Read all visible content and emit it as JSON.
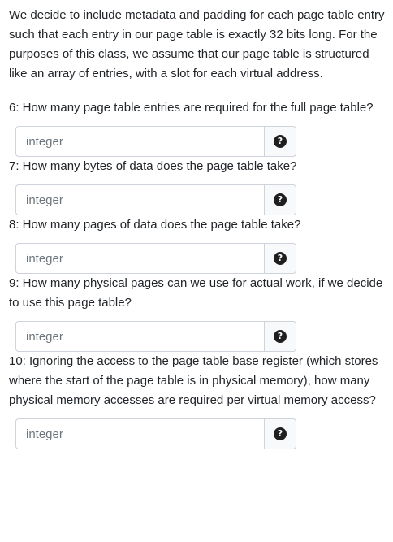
{
  "intro": "We decide to include metadata and padding for each page table entry such that each entry in our page table is exactly 32 bits long. For the purposes of this class, we assume that our page table is structured like an array of entries, with a slot for each virtual address.",
  "questions": [
    {
      "text": "6: How many page table entries are required for the full page table?",
      "placeholder": "integer",
      "help_icon": "question-circle-icon"
    },
    {
      "text": "7: How many bytes of data does the page table take?",
      "placeholder": "integer",
      "help_icon": "question-circle-icon"
    },
    {
      "text": "8: How many pages of data does the page table take?",
      "placeholder": "integer",
      "help_icon": "question-circle-icon"
    },
    {
      "text": "9: How many physical pages can we use for actual work, if we decide to use this page table?",
      "placeholder": "integer",
      "help_icon": "question-circle-icon"
    },
    {
      "text": "10: Ignoring the access to the page table base register (which stores where the start of the page table is in physical memory), how many physical memory accesses are required per virtual memory access?",
      "placeholder": "integer",
      "help_icon": "question-circle-icon"
    }
  ],
  "help_glyph": "?"
}
